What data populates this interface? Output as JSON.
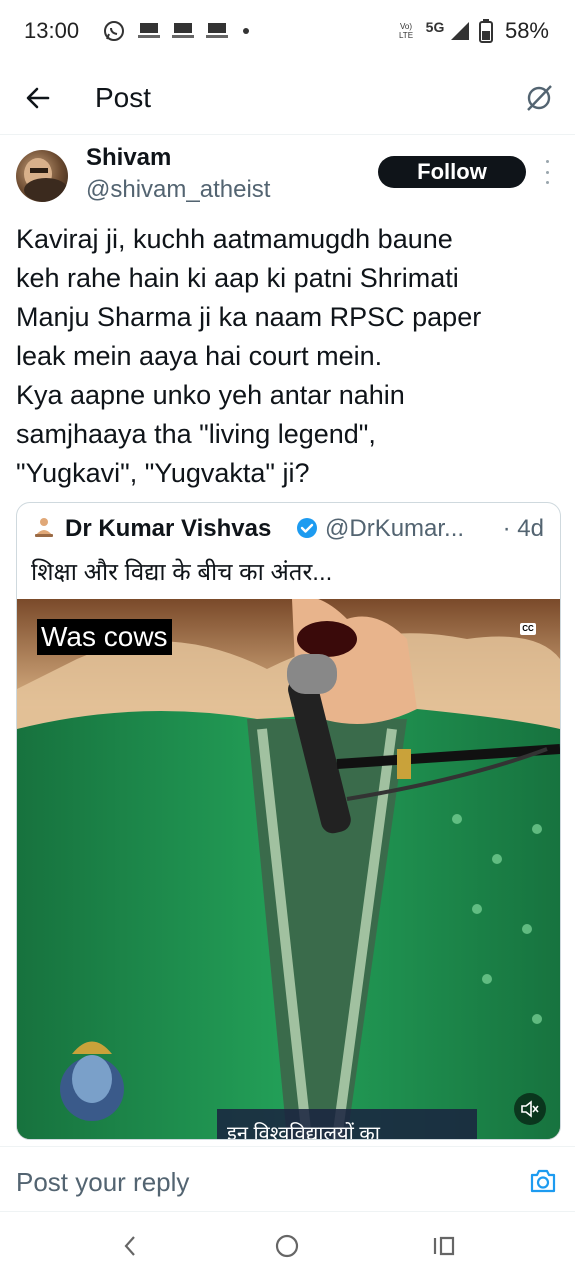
{
  "status_bar": {
    "time": "13:00",
    "network": "5G",
    "lte_label": "Vo)\nLTE",
    "battery": "58%"
  },
  "header": {
    "title": "Post"
  },
  "post": {
    "display_name": "Shivam",
    "handle": "@shivam_atheist",
    "follow_label": "Follow",
    "text_lines": [
      "Kaviraj ji, kuchh aatmamugdh baune",
      "keh rahe hain ki aap ki patni Shrimati",
      "Manju Sharma ji ka naam RPSC paper",
      "leak mein aaya hai court mein.",
      "Kya aapne unko yeh antar nahin",
      "samjhaaya tha \"living legend\",",
      "\"Yugkavi\", \"Yugvakta\" ji?"
    ]
  },
  "quoted": {
    "display_name": "Dr Kumar Vishvas",
    "handle": "@DrKumar...",
    "time": "· 4d",
    "text": "शिक्षा और विद्या के बीच का अंतर...",
    "media": {
      "caption": "Was cows",
      "cc_label": "CC",
      "subtitle": "इन विश्वविद्यालयों का"
    }
  },
  "reply": {
    "placeholder": "Post your reply"
  },
  "colors": {
    "accent": "#1d9bf0",
    "text_primary": "#0f1419",
    "text_secondary": "#536471",
    "follow_bg": "#0f1419",
    "kurta_green": "#1f8a4c"
  },
  "icons": [
    "whatsapp-icon",
    "news-app-icon",
    "back-arrow-icon",
    "grok-icon",
    "more-icon",
    "verified-icon",
    "cc-icon",
    "mute-icon",
    "camera-icon",
    "nav-back-icon",
    "nav-home-icon",
    "nav-recents-icon"
  ]
}
